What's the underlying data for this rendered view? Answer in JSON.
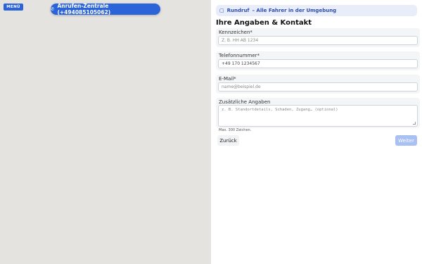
{
  "map": {
    "menu_label": "MENÜ",
    "call_button": {
      "icon": "phone-icon",
      "icon_glyph": "✆",
      "label": "Anrufen-Zentrale (+494085105062)"
    }
  },
  "banner": {
    "icon": "broadcast-icon",
    "icon_glyph": "▢",
    "title": "Rundruf",
    "subtitle": " – Alle Fahrer in der Umgebung"
  },
  "form": {
    "title": "Ihre Angaben & Kontakt",
    "fields": {
      "plate": {
        "label": "Kennzeichen*",
        "placeholder": "Z. B. HH AB 1234",
        "value": ""
      },
      "phone": {
        "label": "Telefonnummer*",
        "placeholder": "",
        "value": "+49 170 1234567"
      },
      "email": {
        "label": "E-Mail*",
        "placeholder": "name@beispiel.de",
        "value": ""
      },
      "notes": {
        "label": "Zusätzliche Angaben",
        "placeholder": "z. B. Standortdetails, Schaden, Zugang… (optional)",
        "value": ""
      }
    },
    "hint": "Max. 300 Zeichen.",
    "back_label": "Zurück",
    "next_label": "Weiter"
  },
  "colors": {
    "accent": "#2b63d9",
    "banner_bg": "#e9edf9",
    "map_bg": "#e5e3df",
    "next_disabled": "#a9c0f2"
  }
}
